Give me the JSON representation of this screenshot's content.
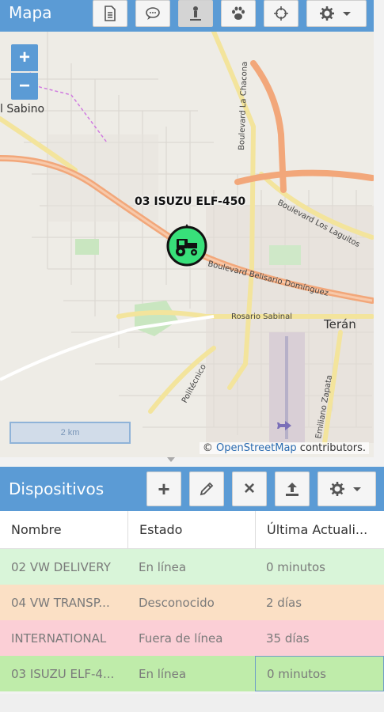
{
  "map": {
    "title": "Mapa",
    "toolbar": {
      "report_icon": "document-icon",
      "messages_icon": "chat-icon",
      "follow_icon": "person-pin-icon",
      "geofence_icon": "paw-icon",
      "locate_icon": "crosshair-icon",
      "settings_icon": "gear-icon"
    },
    "zoom_in": "+",
    "zoom_out": "−",
    "places": {
      "sabino": "l Sabino",
      "teran": "Terán"
    },
    "streets": {
      "la_chacona": "Boulevard La Chacona",
      "los_laguitos": "Boulevard Los Laguitos",
      "belisario": "Boulevard Belisario Domínguez",
      "rosario": "Rosario Sabinal",
      "politecnico": "Politécnico",
      "zapata": "Emiliano Zapata"
    },
    "vehicle_label": "03 ISUZU ELF-450",
    "scale_label": "2 km",
    "attribution_prefix": "© ",
    "attribution_link": "OpenStreetMap",
    "attribution_suffix": " contributors."
  },
  "devices": {
    "title": "Dispositivos",
    "toolbar": {
      "add_label": "+",
      "edit_icon": "pencil-icon",
      "remove_label": "×",
      "share_icon": "upload-icon",
      "settings_icon": "gear-icon"
    },
    "columns": [
      "Nombre",
      "Estado",
      "Última Actuali..."
    ],
    "rows": [
      {
        "name": "02 VW DELIVERY",
        "status": "En línea",
        "updated": "0 minutos",
        "tone": "green"
      },
      {
        "name": "04 VW TRANSP...",
        "status": "Desconocido",
        "updated": "2 días",
        "tone": "orange"
      },
      {
        "name": "INTERNATIONAL",
        "status": "Fuera de línea",
        "updated": "35 días",
        "tone": "red"
      },
      {
        "name": "03 ISUZU ELF-4...",
        "status": "En línea",
        "updated": "0 minutos",
        "tone": "selected"
      }
    ]
  },
  "colors": {
    "header": "#5b9bd5",
    "online": "#d9f5d9",
    "unknown": "#fbe0c5",
    "offline": "#fbcfd6",
    "selected": "#bfecaa",
    "marker": "#38e07a"
  }
}
